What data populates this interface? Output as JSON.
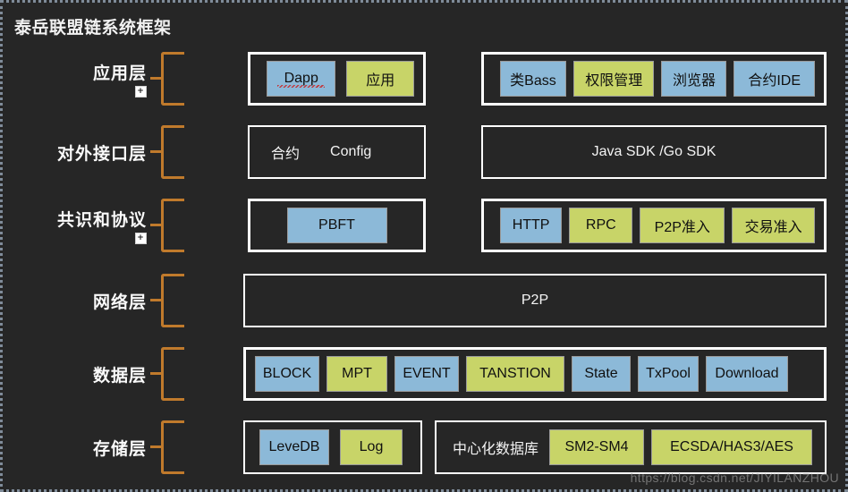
{
  "title": "泰岳联盟链系统框架",
  "watermark": "https://blog.csdn.net/JIYILANZHOU",
  "colors": {
    "background": "#262626",
    "bracket": "#c07a2c",
    "panel_border": "#ffffff",
    "chip_blue": "#8cb9d8",
    "chip_green": "#c8d468",
    "text": "#f3f3f3"
  },
  "layers": [
    {
      "label": "应用层",
      "badge": "+",
      "left_panel": {
        "items": [
          {
            "text": "Dapp",
            "color": "blue",
            "spell_error": true
          },
          {
            "text": "应用",
            "color": "green"
          }
        ]
      },
      "right_panel": {
        "items": [
          {
            "text": "类Bass",
            "color": "blue"
          },
          {
            "text": "权限管理",
            "color": "green"
          },
          {
            "text": "浏览器",
            "color": "blue"
          },
          {
            "text": "合约IDE",
            "color": "blue"
          }
        ]
      }
    },
    {
      "label": "对外接口层",
      "badge": "",
      "left_panel": {
        "plain": [
          "合约",
          "Config"
        ]
      },
      "right_panel": {
        "plain_centered": "Java SDK /Go SDK"
      }
    },
    {
      "label": "共识和协议",
      "badge": "+",
      "left_panel": {
        "items": [
          {
            "text": "PBFT",
            "color": "blue"
          }
        ]
      },
      "right_panel": {
        "items": [
          {
            "text": "HTTP",
            "color": "blue"
          },
          {
            "text": "RPC",
            "color": "green"
          },
          {
            "text": "P2P准入",
            "color": "green"
          },
          {
            "text": "交易准入",
            "color": "green"
          }
        ]
      }
    },
    {
      "label": "网络层",
      "badge": "",
      "full_panel": {
        "plain_centered": "P2P"
      }
    },
    {
      "label": "数据层",
      "badge": "",
      "full_panel": {
        "items": [
          {
            "text": "BLOCK",
            "color": "blue"
          },
          {
            "text": "MPT",
            "color": "green"
          },
          {
            "text": "EVENT",
            "color": "blue"
          },
          {
            "text": "TANSTION",
            "color": "green"
          },
          {
            "text": "State",
            "color": "blue"
          },
          {
            "text": "TxPool",
            "color": "blue"
          },
          {
            "text": "Download",
            "color": "blue"
          }
        ]
      }
    },
    {
      "label": "存储层",
      "badge": "",
      "left_panel": {
        "items": [
          {
            "text": "LeveDB",
            "color": "blue"
          },
          {
            "text": "Log",
            "color": "green"
          }
        ]
      },
      "right_panel": {
        "lead_text": "中心化数据库",
        "items": [
          {
            "text": "SM2-SM4",
            "color": "green"
          },
          {
            "text": "ECSDA/HAS3/AES",
            "color": "green"
          }
        ]
      }
    }
  ]
}
